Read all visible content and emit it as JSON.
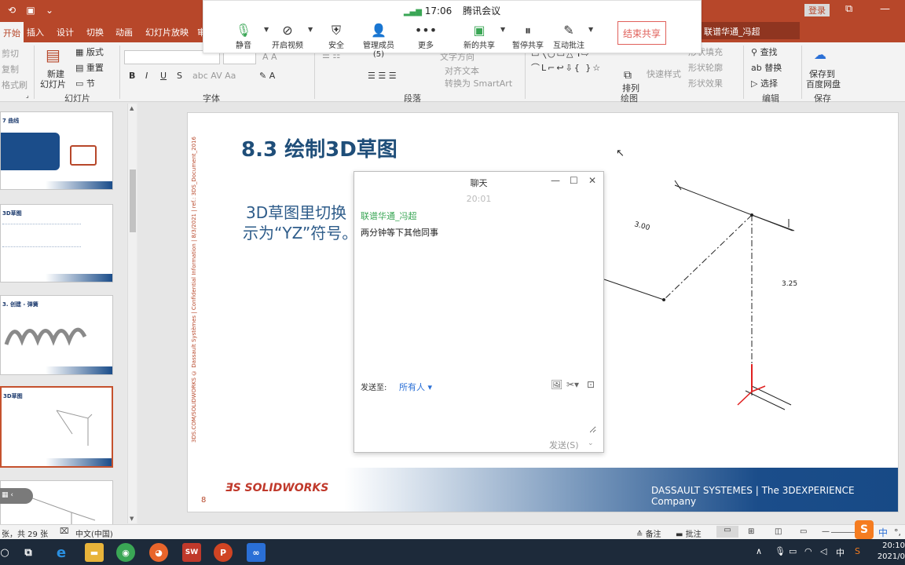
{
  "titlebar": {
    "app_icon": "powerpoint-icon",
    "login": "登录"
  },
  "tabs": {
    "items": [
      "开始",
      "插入",
      "设计",
      "切换",
      "动画",
      "幻灯片放映",
      "审"
    ],
    "active": "开始",
    "tellme": "联谱华通_冯超"
  },
  "ribbon": {
    "clipboard": {
      "cut": "剪切",
      "copy": "复制",
      "format_painter": "格式刷"
    },
    "slides": {
      "new_slide": "新建",
      "new_slide2": "幻灯片",
      "layout": "版式",
      "reset": "重置",
      "section": "节",
      "label": "幻灯片"
    },
    "font": {
      "bold": "B",
      "italic": "I",
      "underline": "U",
      "strike": "S",
      "label": "字体"
    },
    "paragraph": {
      "text_direction": "文字方向",
      "align_text": "对齐文本",
      "smartart": "转换为 SmartArt",
      "label": "段落"
    },
    "drawing": {
      "arrange": "排列",
      "quick_styles": "快速样式",
      "fill": "形状填充",
      "outline": "形状轮廓",
      "effects": "形状效果",
      "label": "绘图"
    },
    "editing": {
      "find": "查找",
      "replace": "替换",
      "select": "选择",
      "label": "编辑"
    },
    "save": {
      "save_to": "保存到",
      "baidu": "百度网盘",
      "label": "保存"
    }
  },
  "meeting": {
    "time": "17:06",
    "app_name": "腾讯会议",
    "buttons": [
      {
        "label": "静音",
        "icon": "microphone-icon"
      },
      {
        "label": "开启视频",
        "icon": "camera-off-icon"
      },
      {
        "label": "安全",
        "icon": "shield-icon"
      },
      {
        "label": "管理成员(5)",
        "icon": "members-icon"
      },
      {
        "label": "更多",
        "icon": "more-icon"
      },
      {
        "label": "新的共享",
        "icon": "share-screen-icon"
      },
      {
        "label": "暂停共享",
        "icon": "pause-icon"
      },
      {
        "label": "互动批注",
        "icon": "annotate-icon"
      }
    ],
    "end_share": "结束共享"
  },
  "slide": {
    "title": "8.3  绘制3D草图",
    "body_line1": "3D草图里切换",
    "body_line2": "示为“YZ”符号。",
    "vertical_text": "3DS.COM/SOLIDWORKS © Dassault Systèmes | Confidential Information | 8/3/2021 | ref.: 3DS_Document_2016",
    "page_num": "8",
    "sw_logo": "SOLIDWORKS",
    "ds_logo": "DASSAULT SYSTEMES | The 3DEXPERIENCE Company",
    "dims": {
      "d1": "3.00",
      "d2": "3.25"
    }
  },
  "chat": {
    "title": "聊天",
    "time": "20:01",
    "sender": "联谱华通_冯超",
    "message": "两分钟等下其他同事",
    "send_to_label": "发送至:",
    "send_to_value": "所有人",
    "send_label": "发送(S)"
  },
  "thumbs": {
    "t1": "7 曲线",
    "t2": "3D草图",
    "t3": "3. 创建 - 弹簧",
    "t4": "3D草图"
  },
  "statusbar": {
    "slide_count": "张，共 29 张",
    "language": "中文(中国)",
    "notes": "备注",
    "comments": "批注"
  },
  "taskbar": {
    "tray_ime": "中",
    "clock_time": "20:10",
    "clock_date": "2021/0"
  }
}
